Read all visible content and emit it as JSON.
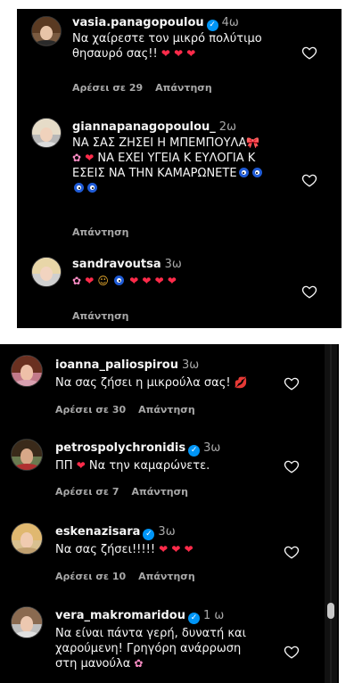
{
  "panel1": {
    "comments": [
      {
        "username": "vasia.panagopoulou",
        "verified": true,
        "time": "4ω",
        "text_lines": [
          "Να χαίρεστε τον μικρό πολύτιμο",
          "θησαυρό σας!!"
        ],
        "likes": "Αρέσει σε 29",
        "reply": "Απάντηση"
      },
      {
        "username": "giannapanagopoulou_",
        "verified": false,
        "time": "2ω",
        "text_lines": [
          "ΝΑ ΣΑΣ ΖΗΣΕΙ Η ΜΠΕΜΠΟΥΛΑ",
          "ΝΑ ΕΧΕΙ ΥΓΕΙΑ Κ ΕΥΛΟΓΙΑ Κ",
          "ΕΣΕΙΣ ΝΑ ΤΗΝ ΚΑΜΑΡΩΝΕΤΕ"
        ],
        "reply": "Απάντηση"
      },
      {
        "username": "sandravoutsa",
        "verified": false,
        "time": "3ω",
        "reply": "Απάντηση"
      }
    ]
  },
  "panel2": {
    "comments": [
      {
        "username": "ioanna_paliospirou",
        "verified": false,
        "time": "3ω",
        "text": "Να σας ζήσει η μικρούλα σας!",
        "likes": "Αρέσει σε 30",
        "reply": "Απάντηση"
      },
      {
        "username": "petrospolychronidis",
        "verified": true,
        "time": "3ω",
        "text_prefix": "ΠΠ",
        "text": "Να την καμαρώνετε.",
        "likes": "Αρέσει σε 7",
        "reply": "Απάντηση"
      },
      {
        "username": "eskenazisara",
        "verified": true,
        "time": "3ω",
        "text": "Να σας ζήσει!!!!!",
        "likes": "Αρέσει σε 10",
        "reply": "Απάντηση"
      },
      {
        "username": "vera_makromaridou",
        "verified": true,
        "time": "1 ω",
        "text_lines": [
          "Να είναι πάντα γερή, δυνατή και",
          "χαρούμενη! Γρηγόρη ανάρρωση",
          "στη μανούλα"
        ]
      }
    ]
  },
  "colors": {
    "background": "#000000",
    "text": "#f5f5f5",
    "secondary": "#a8a8a8",
    "verified": "#0095f6",
    "heart": "#ff2b4a"
  }
}
